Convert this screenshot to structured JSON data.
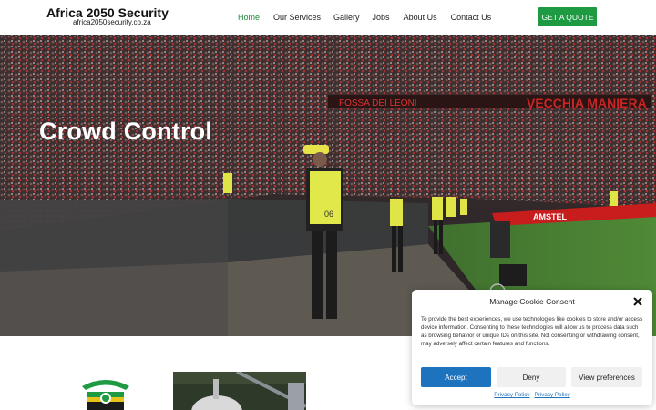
{
  "header": {
    "brand_name": "Africa 2050 Security",
    "brand_url": "africa2050security.co.za",
    "nav": [
      {
        "label": "Home",
        "active": true
      },
      {
        "label": "Our Services",
        "active": false
      },
      {
        "label": "Gallery",
        "active": false
      },
      {
        "label": "Jobs",
        "active": false
      },
      {
        "label": "About Us",
        "active": false
      },
      {
        "label": "Contact Us",
        "active": false
      }
    ],
    "cta_label": "GET A QUOTE"
  },
  "hero": {
    "title": "Crowd Control",
    "stadium_banner_left": "FOSSA DEI LEONI",
    "stadium_banner_right": "VECCHIA MANIERA",
    "ad_board": "AMSTEL",
    "vest_number": "06"
  },
  "cookie_dialog": {
    "title": "Manage Cookie Consent",
    "body": "To provide the best experiences, we use technologies like cookies to store and/or access device information. Consenting to these technologies will allow us to process data such as browsing behavior or unique IDs on this site. Not consenting or withdrawing consent, may adversely affect certain features and functions.",
    "accept_label": "Accept",
    "deny_label": "Deny",
    "preferences_label": "View preferences",
    "links": [
      "Privacy Policy",
      "Privacy Policy"
    ]
  },
  "colors": {
    "brand_green": "#1e9a42",
    "nav_active": "#1f8a3a",
    "accept_blue": "#1e73be"
  }
}
